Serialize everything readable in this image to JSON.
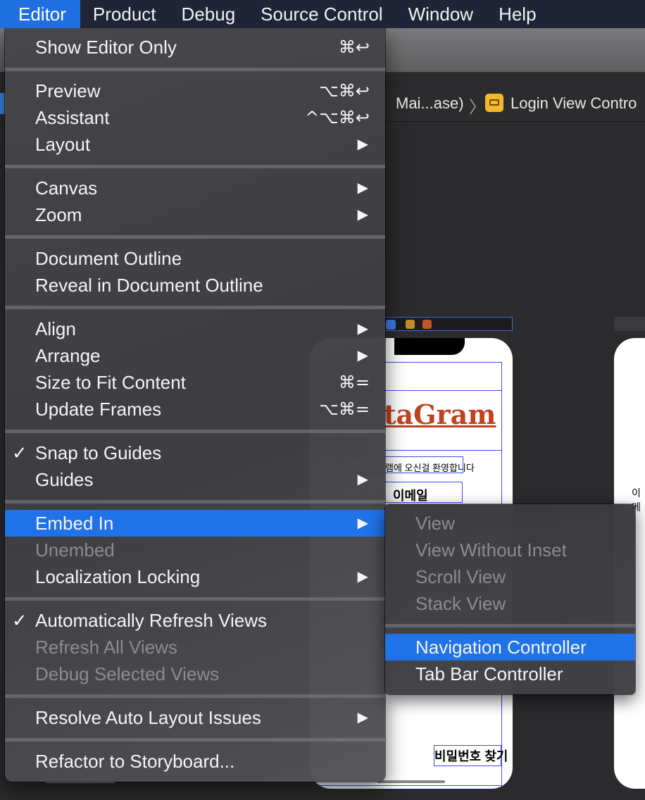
{
  "menubar": {
    "items": [
      "Editor",
      "Product",
      "Debug",
      "Source Control",
      "Window",
      "Help"
    ]
  },
  "jumpbar": {
    "crumb1": "Mai...ase)",
    "separator": "〉",
    "crumb2": "Login View Contro"
  },
  "canvas": {
    "logo_text": "taGram",
    "welcome_text": "램에 오신걸 환영합니다",
    "email_label": "이메일",
    "find_password": "비밀번호 찾기",
    "right_label": "이메"
  },
  "editor_menu": {
    "show_editor_only": {
      "label": "Show Editor Only",
      "shortcut": "⌘↩"
    },
    "preview": {
      "label": "Preview",
      "shortcut": "⌥⌘↩"
    },
    "assistant": {
      "label": "Assistant",
      "shortcut": "^⌥⌘↩"
    },
    "layout": {
      "label": "Layout"
    },
    "canvas": {
      "label": "Canvas"
    },
    "zoom": {
      "label": "Zoom"
    },
    "document_outline": {
      "label": "Document Outline"
    },
    "reveal_in_outline": {
      "label": "Reveal in Document Outline"
    },
    "align": {
      "label": "Align"
    },
    "arrange": {
      "label": "Arrange"
    },
    "size_to_fit": {
      "label": "Size to Fit Content",
      "shortcut": "⌘="
    },
    "update_frames": {
      "label": "Update Frames",
      "shortcut": "⌥⌘="
    },
    "snap_to_guides": {
      "label": "Snap to Guides",
      "checked": "✓"
    },
    "guides": {
      "label": "Guides"
    },
    "embed_in": {
      "label": "Embed In"
    },
    "unembed": {
      "label": "Unembed"
    },
    "localization_locking": {
      "label": "Localization Locking"
    },
    "auto_refresh": {
      "label": "Automatically Refresh Views",
      "checked": "✓"
    },
    "refresh_all": {
      "label": "Refresh All Views"
    },
    "debug_selected": {
      "label": "Debug Selected Views"
    },
    "resolve_auto_layout": {
      "label": "Resolve Auto Layout Issues"
    },
    "refactor": {
      "label": "Refactor to Storyboard..."
    },
    "submenu_arrow": "▶"
  },
  "embed_submenu": {
    "view": "View",
    "view_without_inset": "View Without Inset",
    "scroll_view": "Scroll View",
    "stack_view": "Stack View",
    "navigation_controller": "Navigation Controller",
    "tab_bar_controller": "Tab Bar Controller"
  },
  "colors": {
    "menubar_bg": "#1f2436",
    "highlight": "#1f72e8",
    "disabled_text": "#8c8c8e"
  },
  "icons": {
    "scheme_icon": "view-controller-icon",
    "arrow": "chevron-right-icon",
    "check": "checkmark-icon"
  }
}
